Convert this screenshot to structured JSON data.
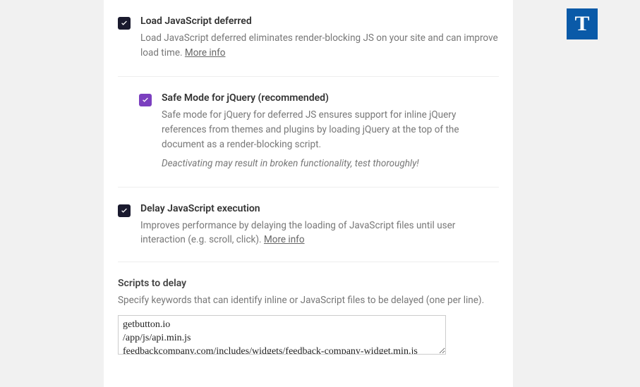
{
  "badge": {
    "letter": "T"
  },
  "sections": {
    "defer": {
      "title": "Load JavaScript deferred",
      "description": "Load JavaScript deferred eliminates render-blocking JS on your site and can improve load time. ",
      "more_info": "More info"
    },
    "safemode": {
      "title": "Safe Mode for jQuery (recommended)",
      "description": "Safe mode for jQuery for deferred JS ensures support for inline jQuery references from themes and plugins by loading jQuery at the top of the document as a render-blocking script.",
      "warning": "Deactivating may result in broken functionality, test thoroughly!"
    },
    "delay": {
      "title": "Delay JavaScript execution",
      "description": "Improves performance by delaying the loading of JavaScript files until user interaction (e.g. scroll, click). ",
      "more_info": "More info",
      "scripts_title": "Scripts to delay",
      "scripts_desc": "Specify keywords that can identify inline or JavaScript files to be delayed (one per line).",
      "scripts_value": "getbutton.io\n/app/js/api.min.js\nfeedbackcompany.com/includes/widgets/feedback-company-widget.min.js"
    }
  }
}
